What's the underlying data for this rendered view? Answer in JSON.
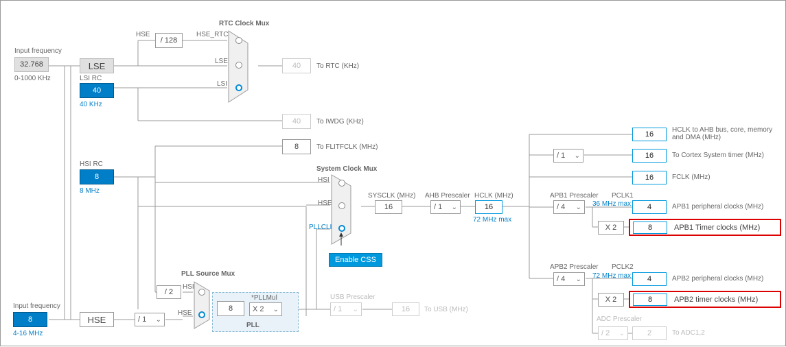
{
  "inputFreq": {
    "label": "Input frequency",
    "value": "32.768",
    "range": "0-1000 KHz"
  },
  "hseInput": {
    "label": "Input frequency",
    "value": "8",
    "range": "4-16 MHz"
  },
  "lse": {
    "label": "LSE"
  },
  "lsi": {
    "label": "LSI RC",
    "value": "40",
    "unit": "40 KHz"
  },
  "hsi": {
    "label": "HSI RC",
    "value": "8",
    "unit": "8 MHz"
  },
  "hse": {
    "label": "HSE"
  },
  "rtcMux": {
    "title": "RTC Clock Mux",
    "in1": "HSE_RTC",
    "in2": "LSE",
    "in3": "LSI",
    "div": "/ 128"
  },
  "rtcOut": {
    "value": "40",
    "label": "To RTC (KHz)"
  },
  "iwdg": {
    "value": "40",
    "label": "To IWDG (KHz)"
  },
  "hseLbl": "HSE",
  "flitf": {
    "value": "8",
    "label": "To FLITFCLK (MHz)"
  },
  "sysMux": {
    "title": "System Clock Mux",
    "in1": "HSI",
    "in2": "HSE",
    "in3": "PLLCLK"
  },
  "css": "Enable CSS",
  "sysclk": {
    "label": "SYSCLK (MHz)",
    "value": "16"
  },
  "ahb": {
    "label": "AHB Prescaler",
    "value": "/ 1"
  },
  "hclk": {
    "label": "HCLK (MHz)",
    "value": "16",
    "max": "72 MHz max"
  },
  "pllMux": {
    "title": "PLL Source Mux",
    "in1": "HSI",
    "in2": "HSE",
    "div": "/ 2",
    "presc": "/ 1"
  },
  "pll": {
    "label": "PLL",
    "value": "8",
    "mulLabel": "*PLLMul",
    "mul": "X 2"
  },
  "usb": {
    "label": "USB Prescaler",
    "value": "/ 1",
    "out": "16",
    "outLabel": "To USB (MHz)"
  },
  "cortexDiv": "/ 1",
  "out_ahb": {
    "value": "16",
    "label": "HCLK to AHB bus, core, memory and DMA (MHz)"
  },
  "out_cortex": {
    "value": "16",
    "label": "To Cortex System timer (MHz)"
  },
  "out_fclk": {
    "value": "16",
    "label": "FCLK (MHz)"
  },
  "apb1": {
    "label": "APB1 Prescaler",
    "value": "/ 4",
    "pclk": "PCLK1",
    "max": "36 MHz max",
    "periph": "4",
    "periphLabel": "APB1 peripheral clocks (MHz)",
    "mul": "X 2",
    "timer": "8",
    "timerLabel": "APB1 Timer clocks (MHz)"
  },
  "apb2": {
    "label": "APB2 Prescaler",
    "value": "/ 4",
    "pclk": "PCLK2",
    "max": "72 MHz max",
    "periph": "4",
    "periphLabel": "APB2 peripheral clocks (MHz)",
    "mul": "X 2",
    "timer": "8",
    "timerLabel": "APB2 timer clocks (MHz)"
  },
  "adc": {
    "label": "ADC Prescaler",
    "value": "/ 2",
    "out": "2",
    "outLabel": "To ADC1,2"
  }
}
